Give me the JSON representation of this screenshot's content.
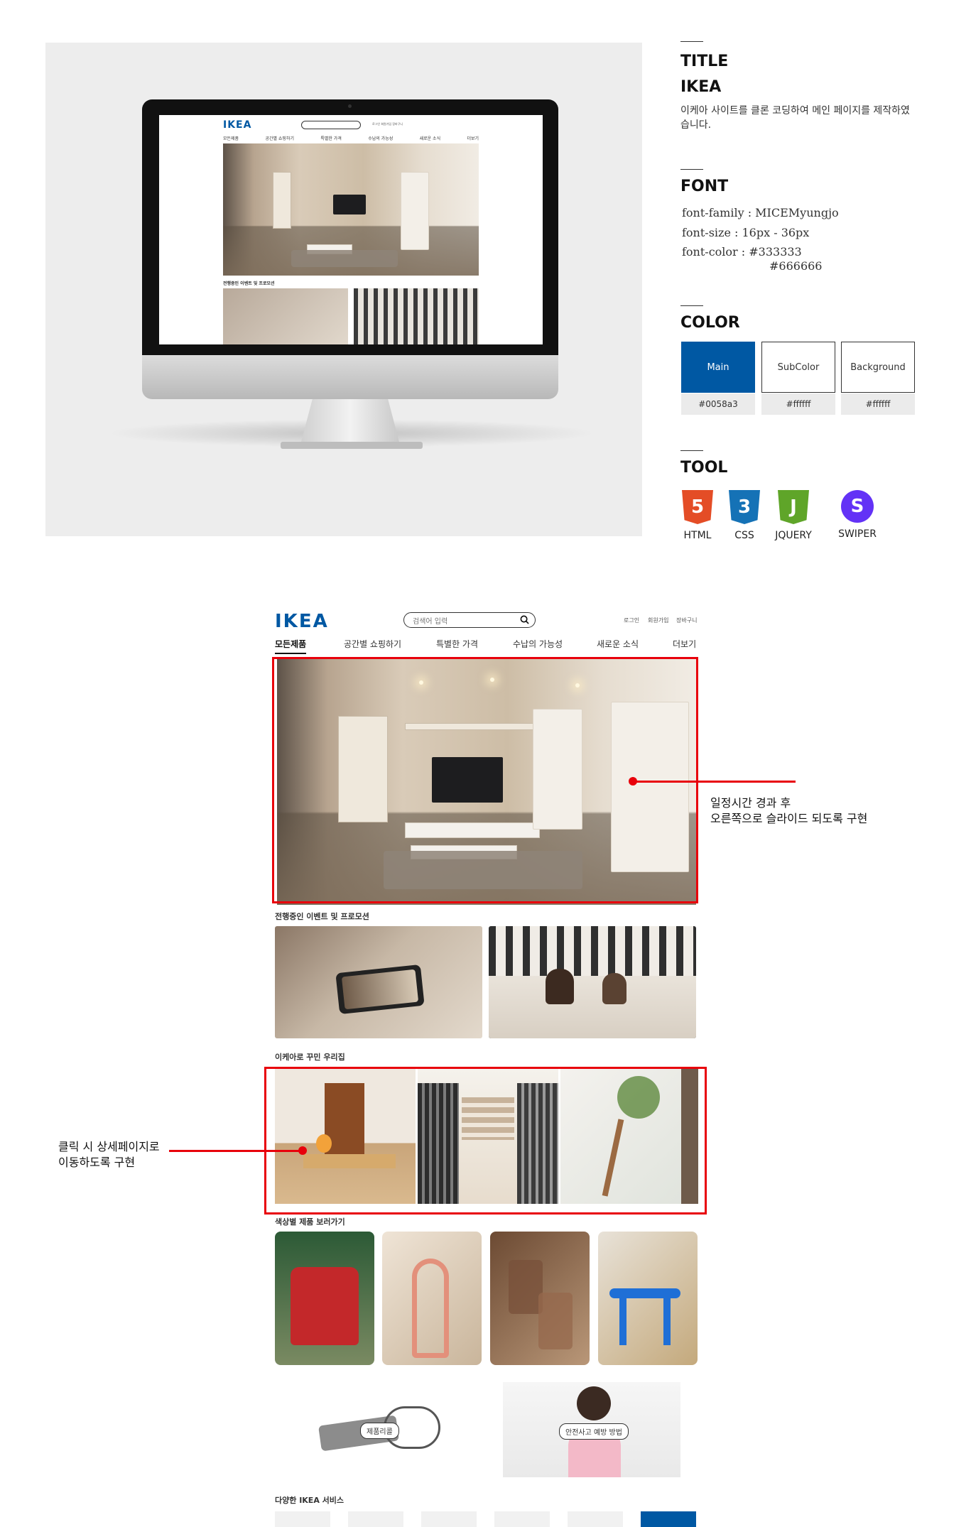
{
  "info": {
    "title_heading": "TITLE",
    "title_name": "IKEA",
    "description": "이케아 사이트를 클론 코딩하여 메인 페이지를 제작하였습니다.",
    "font_heading": "FONT",
    "font_family": "font-family :  MICEMyungjo",
    "font_size": "font-size : 16px - 36px",
    "font_color": "font-color : #333333",
    "font_color_2": "#666666",
    "color_heading": "COLOR",
    "colors": [
      {
        "name": "Main",
        "hex": "#0058a3",
        "fill": "#0058a3"
      },
      {
        "name": "SubColor",
        "hex": "#ffffff",
        "fill": "#ffffff"
      },
      {
        "name": "Background",
        "hex": "#ffffff",
        "fill": "#ffffff"
      }
    ],
    "tool_heading": "TOOL",
    "tools": [
      {
        "label": "HTML",
        "glyph": "5",
        "color": "#e44d26",
        "icon": "html5-icon"
      },
      {
        "label": "CSS",
        "glyph": "3",
        "color": "#1572b6",
        "icon": "css3-icon"
      },
      {
        "label": "JQUERY",
        "glyph": "J",
        "color": "#5fa529",
        "icon": "javascript-icon"
      },
      {
        "label": "SWIPER",
        "glyph": "S",
        "color": "#6332f6",
        "icon": "swiper-icon"
      }
    ]
  },
  "site": {
    "logo": "IKEA",
    "search_placeholder": "검색어 입력",
    "util_links": [
      "로그인",
      "회원가입",
      "장바구니"
    ],
    "nav": [
      "모든제품",
      "공간별 쇼핑하기",
      "특별한 가격",
      "수납의 가능성",
      "새로운 소식",
      "더보기"
    ],
    "section_events": "전행중인 이벤트 및 프로모션",
    "section_homes": "이케아로 꾸민 우리집",
    "section_colors": "색상별 제품 보러가기",
    "section_services": "다양한 IKEA 서비스",
    "pill_recall": "제품리콜",
    "pill_safety": "안전사고 예방 방법"
  },
  "annotations": {
    "slider_note_1": "일정시간 경과 후",
    "slider_note_2": "오른쪽으로 슬라이드 되도록 구현",
    "click_note_1": "클릭 시 상세페이지로",
    "click_note_2": "이동하도록 구현"
  },
  "colors": {
    "accent": "#0058a3",
    "annotation_red": "#e8000b",
    "text": "#333333"
  }
}
